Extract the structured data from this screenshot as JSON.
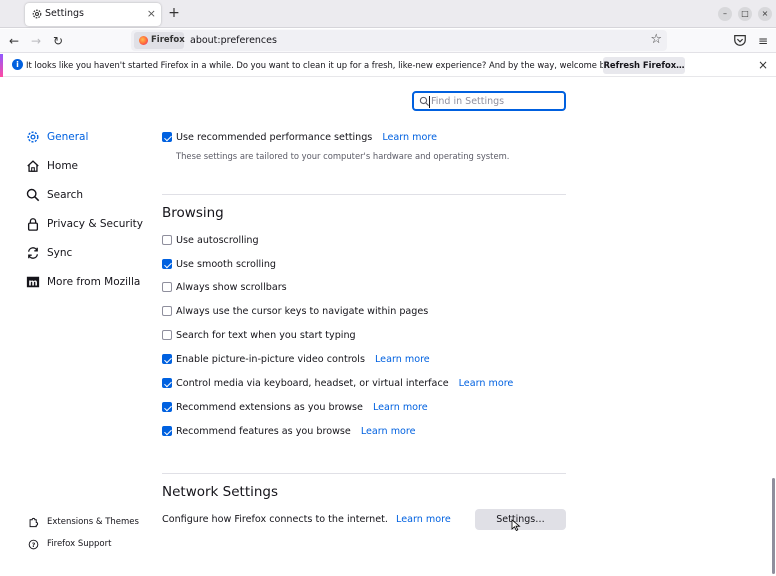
{
  "tab": {
    "title": "Settings",
    "close": "×",
    "new_tab": "+"
  },
  "window_controls": {
    "minimize": "–",
    "maximize": "□",
    "close": "×"
  },
  "nav": {
    "back": "←",
    "forward": "→",
    "reload": "↻"
  },
  "urlbar": {
    "identity_label": "Firefox",
    "url": "about:preferences",
    "star": "☆"
  },
  "toolbar": {
    "menu": "≡"
  },
  "notification": {
    "text": "It looks like you haven't started Firefox in a while. Do you want to clean it up for a fresh, like-new experience? And by the way, welcome back!",
    "button": "Refresh Firefox…",
    "close": "×",
    "accent_colors": [
      "#9059ff",
      "#ff4aa2"
    ]
  },
  "search": {
    "placeholder": "Find in Settings"
  },
  "sidebar": {
    "items": [
      {
        "label": "General",
        "icon": "gear-icon",
        "active": true
      },
      {
        "label": "Home",
        "icon": "home-icon"
      },
      {
        "label": "Search",
        "icon": "search-icon"
      },
      {
        "label": "Privacy & Security",
        "icon": "lock-icon"
      },
      {
        "label": "Sync",
        "icon": "sync-icon"
      },
      {
        "label": "More from Mozilla",
        "icon": "mozilla-icon"
      }
    ],
    "footer": [
      {
        "label": "Extensions & Themes",
        "icon": "puzzle-icon"
      },
      {
        "label": "Firefox Support",
        "icon": "help-icon"
      }
    ]
  },
  "performance": {
    "label": "Use recommended performance settings",
    "checked": true,
    "learn_more": "Learn more",
    "description": "These settings are tailored to your computer's hardware and operating system."
  },
  "browsing": {
    "title": "Browsing",
    "options": [
      {
        "label": "Use autoscrolling",
        "checked": false
      },
      {
        "label": "Use smooth scrolling",
        "checked": true
      },
      {
        "label": "Always show scrollbars",
        "checked": false
      },
      {
        "label": "Always use the cursor keys to navigate within pages",
        "checked": false
      },
      {
        "label": "Search for text when you start typing",
        "checked": false
      },
      {
        "label": "Enable picture-in-picture video controls",
        "checked": true,
        "learn_more": "Learn more"
      },
      {
        "label": "Control media via keyboard, headset, or virtual interface",
        "checked": true,
        "learn_more": "Learn more"
      },
      {
        "label": "Recommend extensions as you browse",
        "checked": true,
        "learn_more": "Learn more"
      },
      {
        "label": "Recommend features as you browse",
        "checked": true,
        "learn_more": "Learn more"
      }
    ]
  },
  "network": {
    "title": "Network Settings",
    "description": "Configure how Firefox connects to the internet.",
    "learn_more": "Learn more",
    "button": "Settings…"
  },
  "colors": {
    "accent": "#0061e0",
    "focus": "#0060df"
  }
}
